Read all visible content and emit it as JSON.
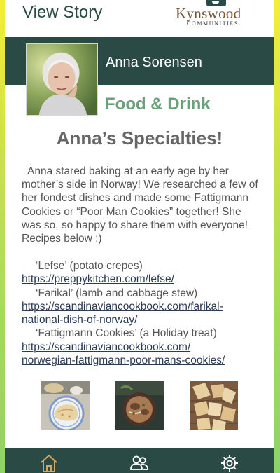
{
  "topbar": {
    "title": "View Story",
    "logo_brand": "Kynswood",
    "logo_sub": "COMMUNITIES"
  },
  "profile": {
    "name": "Anna Sorensen",
    "category": "Food & Drink",
    "photo_icon": "resident-portrait"
  },
  "story": {
    "heading": "Anna’s Specialties!",
    "paragraph": "Anna stared baking at an early age by her mother’s side in Norway! We researched a few of her fondest dishes and made some Fattigmann Cookies or “Poor Man Cookies” together! She was so, so happy to share them with everyone! Recipes below :)",
    "recipes": [
      {
        "name": "‘Lefse’ (potato crepes)",
        "link": "https://preppykitchen.com/lefse/"
      },
      {
        "name": "‘Farikal’ (lamb and cabbage stew)",
        "link_lines": [
          "https://scandinaviancookbook.com/farikal-",
          "national-dish-of-norway/"
        ]
      },
      {
        "name": "‘Fattigmann Cookies’ (a Holiday treat)",
        "link_lines": [
          "https://scandinaviancookbook.com/",
          "norwegian-fattigmann-poor-mans-cookies/"
        ]
      }
    ]
  },
  "thumbnails": [
    "lefse-photo",
    "farikal-stew-photo",
    "fattigmann-cookies-photo"
  ],
  "bottom_nav": [
    "home-icon",
    "people-icon",
    "settings-gear-icon"
  ],
  "colors": {
    "primary": "#2a4a45",
    "accent_green": "#6aa07a",
    "nav_icon": "#d9a35a",
    "nav_icon_inactive": "#ffffff"
  }
}
